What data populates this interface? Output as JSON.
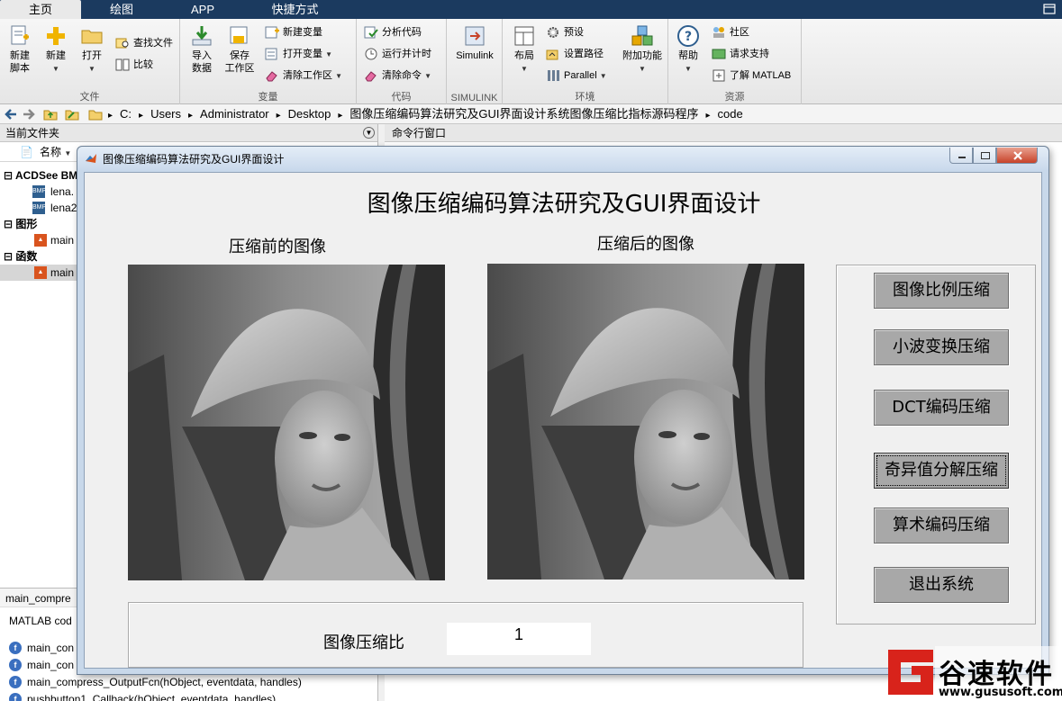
{
  "ribbon_tabs": [
    "主页",
    "绘图",
    "APP",
    "快捷方式"
  ],
  "ribbon": {
    "file": {
      "title": "文件",
      "new_script": "新建\n脚本",
      "new": "新建",
      "open": "打开",
      "find_files": "查找文件",
      "compare": "比较"
    },
    "variable": {
      "title": "变量",
      "import": "导入\n数据",
      "save_ws": "保存\n工作区",
      "new_var": "新建变量",
      "open_var": "打开变量",
      "clear_ws": "清除工作区"
    },
    "code": {
      "title": "代码",
      "analyze": "分析代码",
      "run_time": "运行并计时",
      "clear_cmd": "清除命令"
    },
    "simulink": {
      "title": "SIMULINK",
      "label": "Simulink"
    },
    "env": {
      "title": "环境",
      "layout": "布局",
      "prefs": "预设",
      "set_path": "设置路径",
      "parallel": "Parallel",
      "addons": "附加功能"
    },
    "resources": {
      "title": "资源",
      "help": "帮助",
      "community": "社区",
      "support": "请求支持",
      "learn": "了解 MATLAB"
    }
  },
  "address": {
    "crumbs": [
      "C:",
      "Users",
      "Administrator",
      "Desktop",
      "图像压缩编码算法研究及GUI界面设计系统图像压缩比指标源码程序",
      "code"
    ]
  },
  "left_panel": {
    "title": "当前文件夹",
    "col_name": "名称",
    "groups": [
      {
        "label": "ACDSee BM",
        "items": [
          "lena.",
          "lena2"
        ]
      },
      {
        "label": "图形",
        "items": [
          "main"
        ]
      },
      {
        "label": "函数",
        "items": [
          "main"
        ]
      }
    ],
    "detail_title": "main_compre",
    "detail_sub": "MATLAB cod",
    "functions": [
      "main_con",
      "main_con",
      "main_compress_OutputFcn(hObject, eventdata, handles)",
      "pushbutton1_Callback(hObject, eventdata, handles)"
    ]
  },
  "command_window": {
    "title": "命令行窗口"
  },
  "figure": {
    "window_title": "图像压缩编码算法研究及GUI界面设计",
    "gui_title": "图像压缩编码算法研究及GUI界面设计",
    "label_before": "压缩前的图像",
    "label_after": "压缩后的图像",
    "buttons": [
      "图像比例压缩",
      "小波变换压缩",
      "DCT编码压缩",
      "奇异值分解压缩",
      "算术编码压缩",
      "退出系统"
    ],
    "ratio_label": "图像压缩比",
    "ratio_value": "1"
  },
  "watermark": {
    "brand": "谷速软件",
    "url": "www.gususoft.com"
  }
}
